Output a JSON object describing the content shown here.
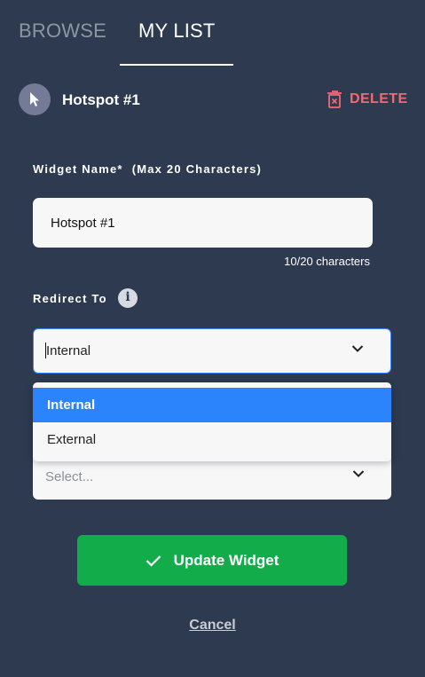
{
  "tabs": [
    {
      "label": "BROWSE",
      "active": false
    },
    {
      "label": "MY LIST",
      "active": true
    }
  ],
  "widget": {
    "title": "Hotspot #1",
    "icon": "cursor-pointer-icon",
    "delete_label": "DELETE"
  },
  "form": {
    "name_label": "Widget Name*",
    "name_hint": "(Max 20 Characters)",
    "name_value": "Hotspot #1",
    "char_count": "10/20 characters",
    "redirect_label": "Redirect To",
    "redirect_value": "Internal",
    "redirect_options": [
      "Internal",
      "External"
    ],
    "second_select_placeholder": "Select..."
  },
  "actions": {
    "update_label": "Update Widget",
    "cancel_label": "Cancel"
  },
  "colors": {
    "background": "#2d3a4f",
    "delete": "#f06a72",
    "selected_option": "#2b84fb",
    "update_button": "#12ad4a",
    "focus_border": "#3b82f6"
  }
}
